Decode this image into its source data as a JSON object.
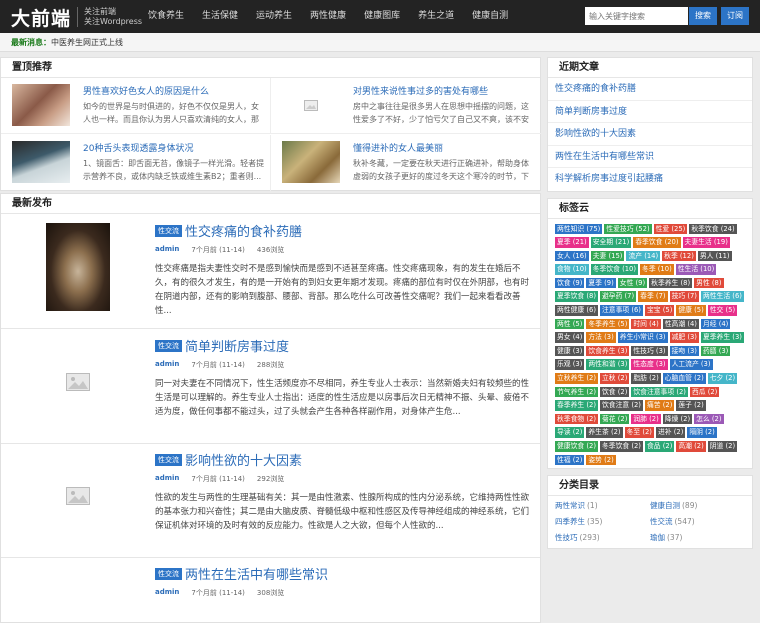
{
  "header": {
    "logo": "大前端",
    "logo_sub1": "关注前端",
    "logo_sub2": "关注Wordpress",
    "nav": [
      "饮食养生",
      "生活保健",
      "运动养生",
      "两性健康",
      "健康图库",
      "养生之道",
      "健康自测"
    ],
    "search_placeholder": "输入关键字搜索",
    "search_button": "搜索",
    "subscribe": "订阅"
  },
  "notice": {
    "label": "最新消息：",
    "text": "中医养生网正式上线"
  },
  "top": {
    "title": "置顶推荐",
    "items": [
      {
        "title": "男性喜欢好色女人的原因是什么",
        "desc": "如今的世界是与时俱进的，好色不仅仅是男人，女人也一样。而且你认为男人只喜欢清纯的女人，那你就错"
      },
      {
        "title": "对男性来说性事过多的害处有哪些",
        "desc": "房中之事往往是很多男人在思想中摇摆的问题，这性爱多了不好，少了怕亏欠了自己又不爽，该不安伴侣还要抱怨。"
      },
      {
        "title": "20种舌头表现透露身体状况",
        "desc": "1、镜面舌：即舌面无苔，像镜子一样光滑。轻者提示营养不良，或体内缺乏铁或维生素B2；重者则..."
      },
      {
        "title": "懂得进补的女人最美丽",
        "desc": "秋补冬藏，一定要在秋天进行正确进补，帮助身体虚弱的女孩子更好的度过冬天这个寒冷的时节，下面"
      }
    ]
  },
  "latest": {
    "title": "最新发布",
    "posts": [
      {
        "cat": "性交流",
        "title": "性交疼痛的食补药膳",
        "author": "admin",
        "time": "7个月前 (11-14)",
        "views": "436浏览",
        "excerpt": "性交疼痛是指夫妻性交时不是感到愉快而是感到不适甚至疼痛。性交疼痛现象，有的发生在婚后不久，有的很久才发生，有的是一开始有的到妇女更年期才发现。疼痛的部位有时仅在外阴部，也有时在阴道内部，还有的影响到腹部、腰部、背部。那么吃什么可改善性交痛呢？我们一起来看看改善性..."
      },
      {
        "cat": "性交流",
        "title": "简单判断房事过度",
        "author": "admin",
        "time": "7个月前 (11-14)",
        "views": "288浏览",
        "excerpt": "同一对夫妻在不同情况下，性生活频度亦不尽相同，养生专业人士表示：当然新婚夫妇有较频些的性生活是可以理解的。养生专业人士指出：适度的性生活应是以房事后次日无精神不振、头晕、疲倦不适为度，做任何事都不能过头，过了头就会产生各种各样副作用，对身体产生危..."
      },
      {
        "cat": "性交流",
        "title": "影响性欲的十大因素",
        "author": "admin",
        "time": "7个月前 (11-14)",
        "views": "292浏览",
        "excerpt": "性欲的发生与两性的生理基础有关：其一是由性激素、性腺所构成的性内分泌系统，它维持两性性欲的基本张力和兴奋性；其二是由大脑皮质、脊髓低级中枢和性感区及传导神经组成的神经系统，它们保证机体对环境的及时有效的反应能力。性欲是人之大欲，但每个人性欲的..."
      },
      {
        "cat": "性交流",
        "title": "两性在生活中有哪些常识",
        "author": "admin",
        "time": "7个月前 (11-14)",
        "views": "308浏览",
        "excerpt": ""
      }
    ]
  },
  "recent": {
    "title": "近期文章",
    "items": [
      "性交疼痛的食补药膳",
      "简单判断房事过度",
      "影响性欲的十大因素",
      "两性在生活中有哪些常识",
      "科学解析房事过度引起腰痛"
    ]
  },
  "tags": {
    "title": "标签云",
    "items": [
      {
        "t": "两性知识 (75)",
        "c": "#2c74c7"
      },
      {
        "t": "性爱技巧 (52)",
        "c": "#34a853"
      },
      {
        "t": "性爱 (25)",
        "c": "#e04a3a"
      },
      {
        "t": "秋季饮食 (24)",
        "c": "#555555"
      },
      {
        "t": "夏季 (21)",
        "c": "#e8308a"
      },
      {
        "t": "安全期 (21)",
        "c": "#2aa876"
      },
      {
        "t": "春季饮食 (20)",
        "c": "#e07b16"
      },
      {
        "t": "夫妻生活 (19)",
        "c": "#e8308a"
      },
      {
        "t": "女人 (16)",
        "c": "#2c74c7"
      },
      {
        "t": "夫妻 (15)",
        "c": "#34a853"
      },
      {
        "t": "流产 (14)",
        "c": "#45b6c9"
      },
      {
        "t": "秋季 (12)",
        "c": "#e04a3a"
      },
      {
        "t": "男人 (11)",
        "c": "#555555"
      },
      {
        "t": "食物 (10)",
        "c": "#45b6c9"
      },
      {
        "t": "冬季饮食 (10)",
        "c": "#2aa876"
      },
      {
        "t": "冬季 (10)",
        "c": "#e07b16"
      },
      {
        "t": "性生活 (10)",
        "c": "#9b59b6"
      },
      {
        "t": "饮食 (9)",
        "c": "#2c74c7"
      },
      {
        "t": "夏季 (9)",
        "c": "#2c74c7"
      },
      {
        "t": "女性 (9)",
        "c": "#34a853"
      },
      {
        "t": "秋季养生 (8)",
        "c": "#555555"
      },
      {
        "t": "男性 (8)",
        "c": "#e04a3a"
      },
      {
        "t": "夏季饮食 (8)",
        "c": "#2aa876"
      },
      {
        "t": "避孕药 (7)",
        "c": "#34a853"
      },
      {
        "t": "春季 (7)",
        "c": "#e07b16"
      },
      {
        "t": "技巧 (7)",
        "c": "#e04a3a"
      },
      {
        "t": "两性生活 (6)",
        "c": "#45b6c9"
      },
      {
        "t": "两性健康 (6)",
        "c": "#555555"
      },
      {
        "t": "注意事项 (6)",
        "c": "#2c74c7"
      },
      {
        "t": "宝宝 (5)",
        "c": "#e04a3a"
      },
      {
        "t": "健康 (5)",
        "c": "#e07b16"
      },
      {
        "t": "性交 (5)",
        "c": "#e8308a"
      },
      {
        "t": "两性 (5)",
        "c": "#34a853"
      },
      {
        "t": "冬季养生 (5)",
        "c": "#e07b16"
      },
      {
        "t": "时间 (4)",
        "c": "#e04a3a"
      },
      {
        "t": "性高潮 (4)",
        "c": "#555555"
      },
      {
        "t": "月经 (4)",
        "c": "#2c74c7"
      },
      {
        "t": "男女 (4)",
        "c": "#555555"
      },
      {
        "t": "方法 (3)",
        "c": "#e07b16"
      },
      {
        "t": "养生小常识 (3)",
        "c": "#2c74c7"
      },
      {
        "t": "减肥 (3)",
        "c": "#e04a3a"
      },
      {
        "t": "夏季养生 (3)",
        "c": "#2aa876"
      },
      {
        "t": "健康 (3)",
        "c": "#555555"
      },
      {
        "t": "饮食养生 (3)",
        "c": "#e04a3a"
      },
      {
        "t": "性技巧 (3)",
        "c": "#555555"
      },
      {
        "t": "接吻 (3)",
        "c": "#2c74c7"
      },
      {
        "t": "药膳 (3)",
        "c": "#34a853"
      },
      {
        "t": "乐观 (3)",
        "c": "#555555"
      },
      {
        "t": "两性和谐 (3)",
        "c": "#2aa876"
      },
      {
        "t": "性态度 (3)",
        "c": "#e8308a"
      },
      {
        "t": "人工流产 (3)",
        "c": "#2c74c7"
      },
      {
        "t": "立秋养生 (2)",
        "c": "#e07b16"
      },
      {
        "t": "立秋 (2)",
        "c": "#e04a3a"
      },
      {
        "t": "脂肪 (2)",
        "c": "#555555"
      },
      {
        "t": "心脑血管 (2)",
        "c": "#2c74c7"
      },
      {
        "t": "七夕 (2)",
        "c": "#45b6c9"
      },
      {
        "t": "节气养生 (2)",
        "c": "#34a853"
      },
      {
        "t": "饮食 (2)",
        "c": "#555555"
      },
      {
        "t": "饮食注意事项 (2)",
        "c": "#2aa876"
      },
      {
        "t": "西瓜 (2)",
        "c": "#e04a3a"
      },
      {
        "t": "春季养生 (2)",
        "c": "#2aa876"
      },
      {
        "t": "饮食注意 (2)",
        "c": "#555555"
      },
      {
        "t": "痛苦 (2)",
        "c": "#e07b16"
      },
      {
        "t": "莲子 (2)",
        "c": "#555555"
      },
      {
        "t": "秋季食物 (2)",
        "c": "#e04a3a"
      },
      {
        "t": "菊花 (2)",
        "c": "#34a853"
      },
      {
        "t": "润肺 (2)",
        "c": "#e8308a"
      },
      {
        "t": "降燥 (2)",
        "c": "#555555"
      },
      {
        "t": "怎么 (2)",
        "c": "#9b59b6"
      },
      {
        "t": "导读 (2)",
        "c": "#2aa876"
      },
      {
        "t": "养生茶 (2)",
        "c": "#555555"
      },
      {
        "t": "冬至 (2)",
        "c": "#e04a3a"
      },
      {
        "t": "进补 (2)",
        "c": "#555555"
      },
      {
        "t": "隔阴 (2)",
        "c": "#2c74c7"
      },
      {
        "t": "健康饮食 (2)",
        "c": "#34a853"
      },
      {
        "t": "冬季饮食 (2)",
        "c": "#555555"
      },
      {
        "t": "食品 (2)",
        "c": "#2aa876"
      },
      {
        "t": "高潮 (2)",
        "c": "#e04a3a"
      },
      {
        "t": "阴道 (2)",
        "c": "#555555"
      },
      {
        "t": "性福 (2)",
        "c": "#2c74c7"
      },
      {
        "t": "姿势 (2)",
        "c": "#e07b16"
      }
    ]
  },
  "categories": {
    "title": "分类目录",
    "items": [
      {
        "name": "两性常识",
        "count": "(1)"
      },
      {
        "name": "健康自测",
        "count": "(89)"
      },
      {
        "name": "四季养生",
        "count": "(35)"
      },
      {
        "name": "性交流",
        "count": "(547)"
      },
      {
        "name": "性技巧",
        "count": "(293)"
      },
      {
        "name": "瑜伽",
        "count": "(37)"
      }
    ]
  },
  "colors": {
    "link": "#2c6cb8",
    "accent": "#2c74c7",
    "header_bg": "#232323"
  }
}
